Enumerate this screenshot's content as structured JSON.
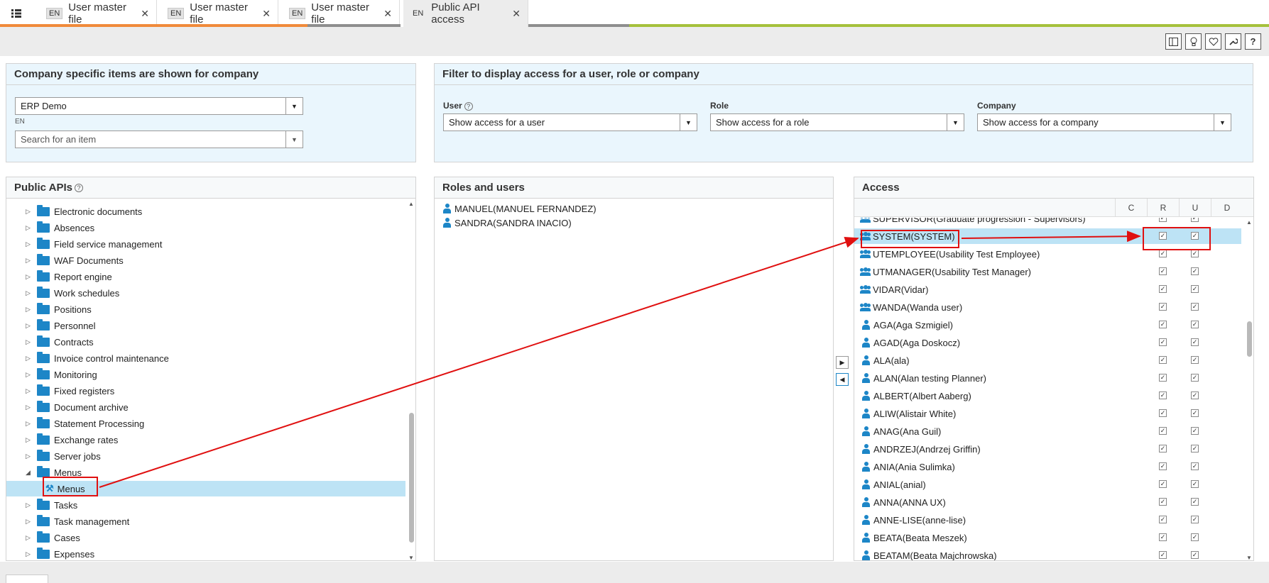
{
  "tabs": [
    {
      "lang": "EN",
      "label": "User master file"
    },
    {
      "lang": "EN",
      "label": "User master file"
    },
    {
      "lang": "EN",
      "label": "User master file"
    },
    {
      "lang": "EN",
      "label": "Public API access"
    }
  ],
  "toolbar": {
    "icons": [
      "split-view-icon",
      "lightbulb-icon",
      "heart-icon",
      "wrench-icon",
      "help-icon"
    ]
  },
  "company_panel": {
    "title": "Company specific items are shown for company",
    "company_value": "ERP Demo",
    "lang": "EN",
    "search_placeholder": "Search for an item"
  },
  "filter_panel": {
    "title": "Filter to display access for a user, role or company",
    "user_label": "User",
    "user_value": "Show access for a user",
    "role_label": "Role",
    "role_value": "Show access for a role",
    "company_label": "Company",
    "company_value": "Show access for a company"
  },
  "apis_panel": {
    "title": "Public APIs",
    "items": [
      "Electronic documents",
      "Absences",
      "Field service management",
      "WAF Documents",
      "Report engine",
      "Work schedules",
      "Positions",
      "Personnel",
      "Contracts",
      "Invoice control maintenance",
      "Monitoring",
      "Fixed registers",
      "Document archive",
      "Statement Processing",
      "Exchange rates",
      "Server jobs",
      "Menus",
      "Menus",
      "Tasks",
      "Task management",
      "Cases",
      "Expenses"
    ]
  },
  "roles_panel": {
    "title": "Roles and users",
    "items": [
      "MANUEL(MANUEL FERNANDEZ)",
      "SANDRA(SANDRA INACIO)"
    ]
  },
  "access_panel": {
    "title": "Access",
    "columns": [
      "C",
      "R",
      "U",
      "D"
    ],
    "rows": [
      {
        "type": "group",
        "label": "SUPERVISOR(Graduate progression - Supervisors)"
      },
      {
        "type": "group",
        "label": "SYSTEM(SYSTEM)"
      },
      {
        "type": "group",
        "label": "UTEMPLOYEE(Usability Test Employee)"
      },
      {
        "type": "group",
        "label": "UTMANAGER(Usability Test Manager)"
      },
      {
        "type": "group",
        "label": "VIDAR(Vidar)"
      },
      {
        "type": "group",
        "label": "WANDA(Wanda user)"
      },
      {
        "type": "user",
        "label": "AGA(Aga Szmigiel)"
      },
      {
        "type": "user",
        "label": "AGAD(Aga Doskocz)"
      },
      {
        "type": "user",
        "label": "ALA(ala)"
      },
      {
        "type": "user",
        "label": "ALAN(Alan testing Planner)"
      },
      {
        "type": "user",
        "label": "ALBERT(Albert Aaberg)"
      },
      {
        "type": "user",
        "label": "ALIW(Alistair White)"
      },
      {
        "type": "user",
        "label": "ANAG(Ana Guil)"
      },
      {
        "type": "user",
        "label": "ANDRZEJ(Andrzej Griffin)"
      },
      {
        "type": "user",
        "label": "ANIA(Ania Sulimka)"
      },
      {
        "type": "user",
        "label": "ANIAL(anial)"
      },
      {
        "type": "user",
        "label": "ANNA(ANNA UX)"
      },
      {
        "type": "user",
        "label": "ANNE-LISE(anne-lise)"
      },
      {
        "type": "user",
        "label": "BEATA(Beata Meszek)"
      },
      {
        "type": "user",
        "label": "BEATAM(Beata Majchrowska)"
      }
    ]
  },
  "colors": {
    "accent": "#1d86c7",
    "selection": "#bde3f5",
    "annotation": "#e01010"
  }
}
